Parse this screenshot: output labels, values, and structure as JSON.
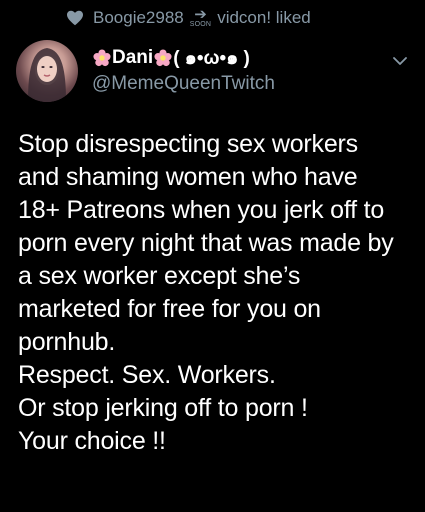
{
  "context": {
    "user": "Boogie2988",
    "badge_text": "SOON",
    "suffix": "vidcon! liked",
    "icon": "heart-icon"
  },
  "author": {
    "display_name_prefix": "Dani",
    "display_name_suffix": "( ๑•ω•๑ )",
    "handle": "@MemeQueenTwitch",
    "name_emoji": "flower-icon"
  },
  "menu": {
    "icon": "chevron-down-icon"
  },
  "tweet": {
    "lines": [
      "Stop disrespecting sex workers",
      "and shaming women who have",
      "18+ Patreons when you jerk off to",
      "porn every night that was made by",
      "a sex worker except she’s",
      "marketed for free for you on",
      "pornhub.",
      "Respect. Sex. Workers.",
      "Or stop jerking off to porn !",
      "Your choice !!"
    ]
  },
  "colors": {
    "background": "#000000",
    "secondary_text": "#8899a6",
    "primary_text": "#ffffff",
    "flower": "#f7a8c4"
  }
}
